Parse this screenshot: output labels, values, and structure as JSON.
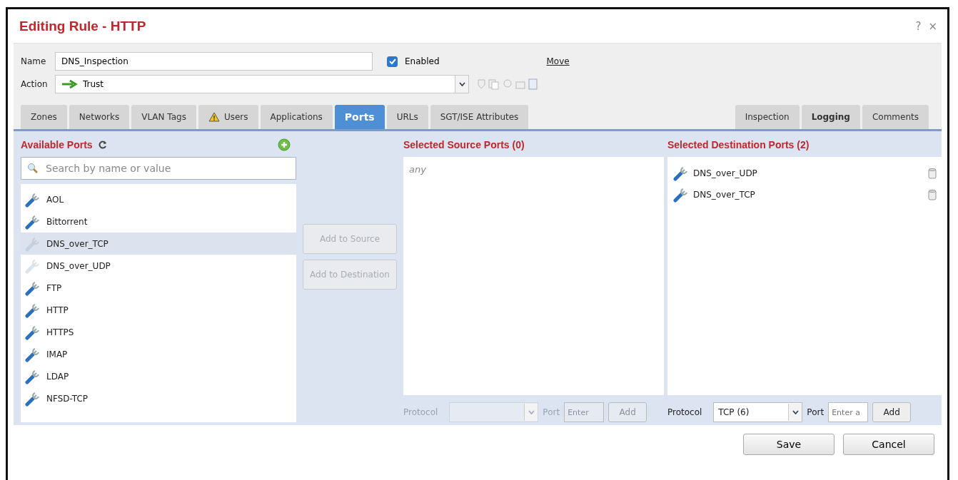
{
  "dialog": {
    "title": "Editing Rule - HTTP",
    "help": "?",
    "close": "×"
  },
  "name_field": {
    "label": "Name",
    "value": "DNS_Inspection"
  },
  "enabled": {
    "label": "Enabled",
    "checked": true
  },
  "move_link": "Move",
  "action_field": {
    "label": "Action",
    "value": "Trust"
  },
  "tabs": [
    {
      "label": "Zones",
      "selected": false,
      "warning": false,
      "bold": false
    },
    {
      "label": "Networks",
      "selected": false,
      "warning": false,
      "bold": false
    },
    {
      "label": "VLAN Tags",
      "selected": false,
      "warning": false,
      "bold": false
    },
    {
      "label": "Users",
      "selected": false,
      "warning": true,
      "bold": false
    },
    {
      "label": "Applications",
      "selected": false,
      "warning": false,
      "bold": false
    },
    {
      "label": "Ports",
      "selected": true,
      "warning": false,
      "bold": false
    },
    {
      "label": "URLs",
      "selected": false,
      "warning": false,
      "bold": false
    },
    {
      "label": "SGT/ISE Attributes",
      "selected": false,
      "warning": false,
      "bold": false
    }
  ],
  "side_tabs": [
    {
      "label": "Inspection",
      "selected": false,
      "warning": false,
      "bold": false
    },
    {
      "label": "Logging",
      "selected": false,
      "warning": false,
      "bold": true
    },
    {
      "label": "Comments",
      "selected": false,
      "warning": false,
      "bold": false
    }
  ],
  "available_ports": {
    "title": "Available Ports",
    "search": {
      "placeholder": "Search by name or value"
    },
    "items": [
      {
        "label": "AOL",
        "selected": false,
        "disabled": false
      },
      {
        "label": "Bittorrent",
        "selected": false,
        "disabled": false
      },
      {
        "label": "DNS_over_TCP",
        "selected": true,
        "disabled": true
      },
      {
        "label": "DNS_over_UDP",
        "selected": false,
        "disabled": true
      },
      {
        "label": "FTP",
        "selected": false,
        "disabled": false
      },
      {
        "label": "HTTP",
        "selected": false,
        "disabled": false
      },
      {
        "label": "HTTPS",
        "selected": false,
        "disabled": false
      },
      {
        "label": "IMAP",
        "selected": false,
        "disabled": false
      },
      {
        "label": "LDAP",
        "selected": false,
        "disabled": false
      },
      {
        "label": "NFSD-TCP",
        "selected": false,
        "disabled": false
      }
    ]
  },
  "move_buttons": [
    {
      "label": "Add to Source",
      "disabled": true
    },
    {
      "label": "Add to Destination",
      "disabled": true
    }
  ],
  "source_ports": {
    "title": "Selected Source Ports (0)",
    "empty_text": "any",
    "protocol_label": "Protocol",
    "port_label": "Port",
    "port_placeholder": "Enter",
    "add": "Add",
    "disabled": true
  },
  "destination_ports": {
    "title": "Selected Destination Ports (2)",
    "items": [
      {
        "label": "DNS_over_UDP"
      },
      {
        "label": "DNS_over_TCP"
      }
    ],
    "protocol_label": "Protocol",
    "protocol_value": "TCP (6)",
    "port_label": "Port",
    "port_placeholder": "Enter a",
    "add": "Add",
    "disabled": false
  },
  "footer_buttons": [
    "Save",
    "Cancel"
  ]
}
